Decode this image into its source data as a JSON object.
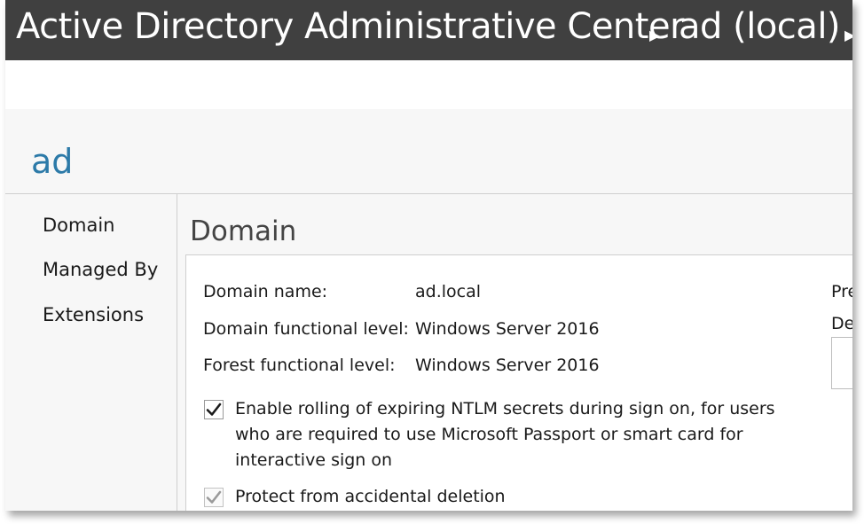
{
  "window": {
    "app_title": "Active Directory Administrative Center",
    "breadcrumb_node": "ad (local)"
  },
  "object": {
    "title": "ad"
  },
  "nav": {
    "items": [
      {
        "label": "Domain"
      },
      {
        "label": "Managed By"
      },
      {
        "label": "Extensions"
      }
    ]
  },
  "section": {
    "title": "Domain",
    "fields": [
      {
        "label": "Domain name:",
        "value": "ad.local"
      },
      {
        "label": "Domain functional level:",
        "value": "Windows Server 2016"
      },
      {
        "label": "Forest functional level:",
        "value": "Windows Server 2016"
      }
    ],
    "checkboxes": [
      {
        "line1": "Enable rolling of expiring NTLM secrets during sign on, for users",
        "line2": "who are required to use Microsoft Passport or smart card for",
        "line3": "interactive sign on",
        "checked": true,
        "enabled": true
      },
      {
        "line1": "Protect from accidental deletion",
        "checked": true,
        "enabled": false
      }
    ],
    "right_column": {
      "label1": "Pre",
      "label2": "De"
    }
  },
  "colors": {
    "titlebar": "#404040",
    "accent": "#2c7aa8"
  }
}
